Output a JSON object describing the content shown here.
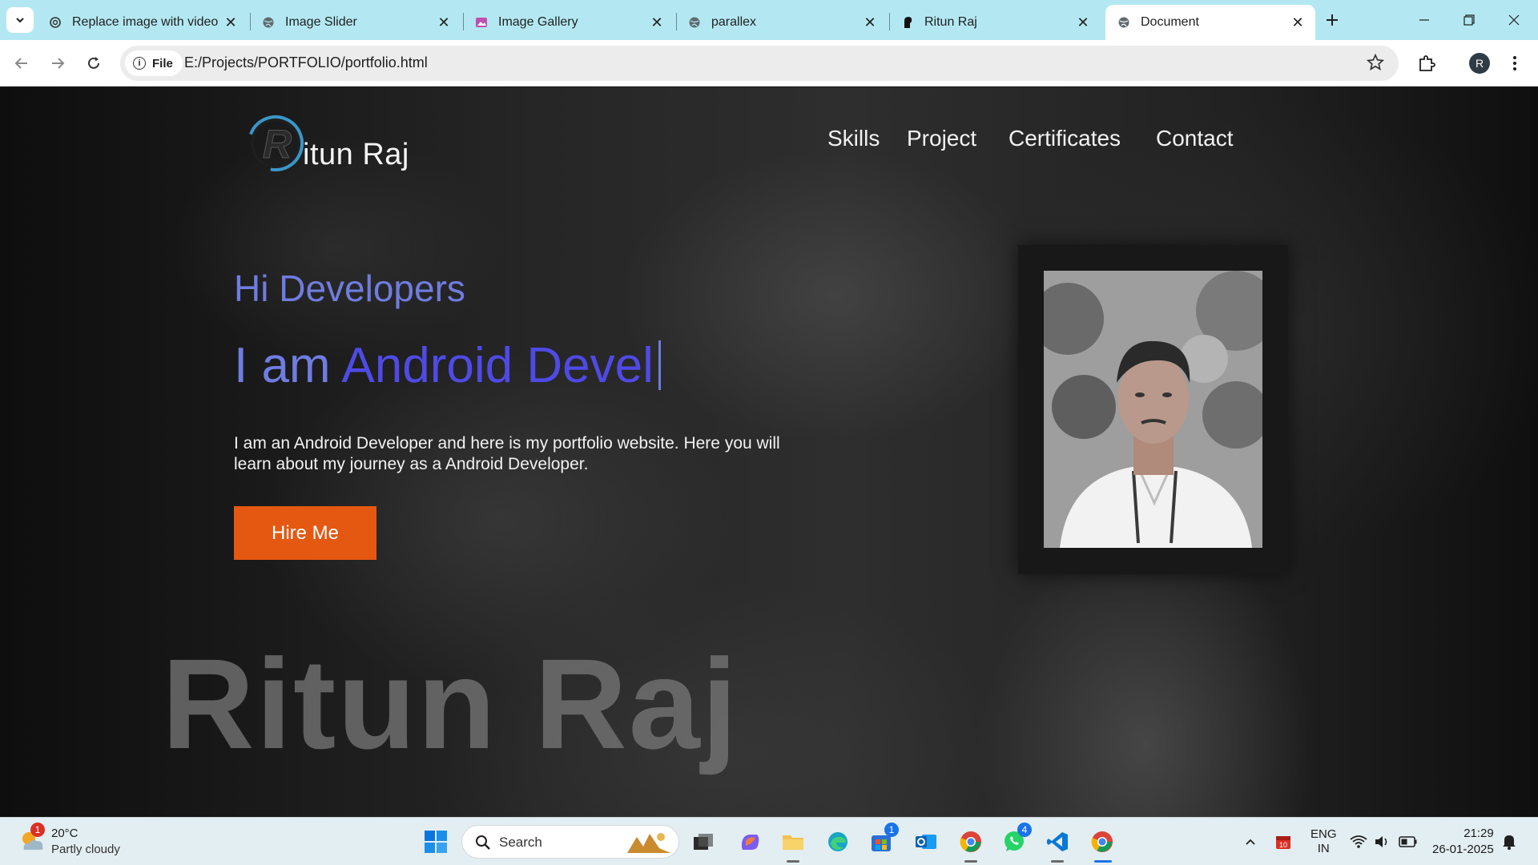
{
  "browser": {
    "tabs": [
      {
        "label": "Replace image with video",
        "icon": "openai-icon"
      },
      {
        "label": "Image Slider",
        "icon": "globe-icon"
      },
      {
        "label": "Image Gallery",
        "icon": "image-icon"
      },
      {
        "label": "parallex",
        "icon": "globe-icon"
      },
      {
        "label": "Ritun Raj",
        "icon": "profile-favicon-icon"
      },
      {
        "label": "Document",
        "icon": "globe-icon"
      }
    ],
    "active_tab": 5,
    "url_chip": "File",
    "url": "E:/Projects/PORTFOLIO/portfolio.html",
    "profile_initial": "R"
  },
  "site": {
    "logo_text": "itun Raj",
    "logo_letter": "R",
    "nav": [
      "Skills",
      "Project",
      "Certificates",
      "Contact"
    ],
    "greeting": "Hi Developers",
    "intro_prefix": "I am",
    "intro_role": "Android Devel",
    "description": "I am an Android Developer and here is my portfolio website. Here you will learn about my journey as a Android Developer.",
    "cta": "Hire Me",
    "watermark": "Ritun Raj",
    "accent_color": "#4f4ae6",
    "cta_color": "#e55812"
  },
  "taskbar": {
    "weather_temp": "20°C",
    "weather_desc": "Partly cloudy",
    "weather_badge": "1",
    "search_label": "Search",
    "store_badge": "1",
    "whatsapp_badge": "4",
    "lang_top": "ENG",
    "lang_bottom": "IN",
    "time": "21:29",
    "date": "26-01-2025"
  }
}
